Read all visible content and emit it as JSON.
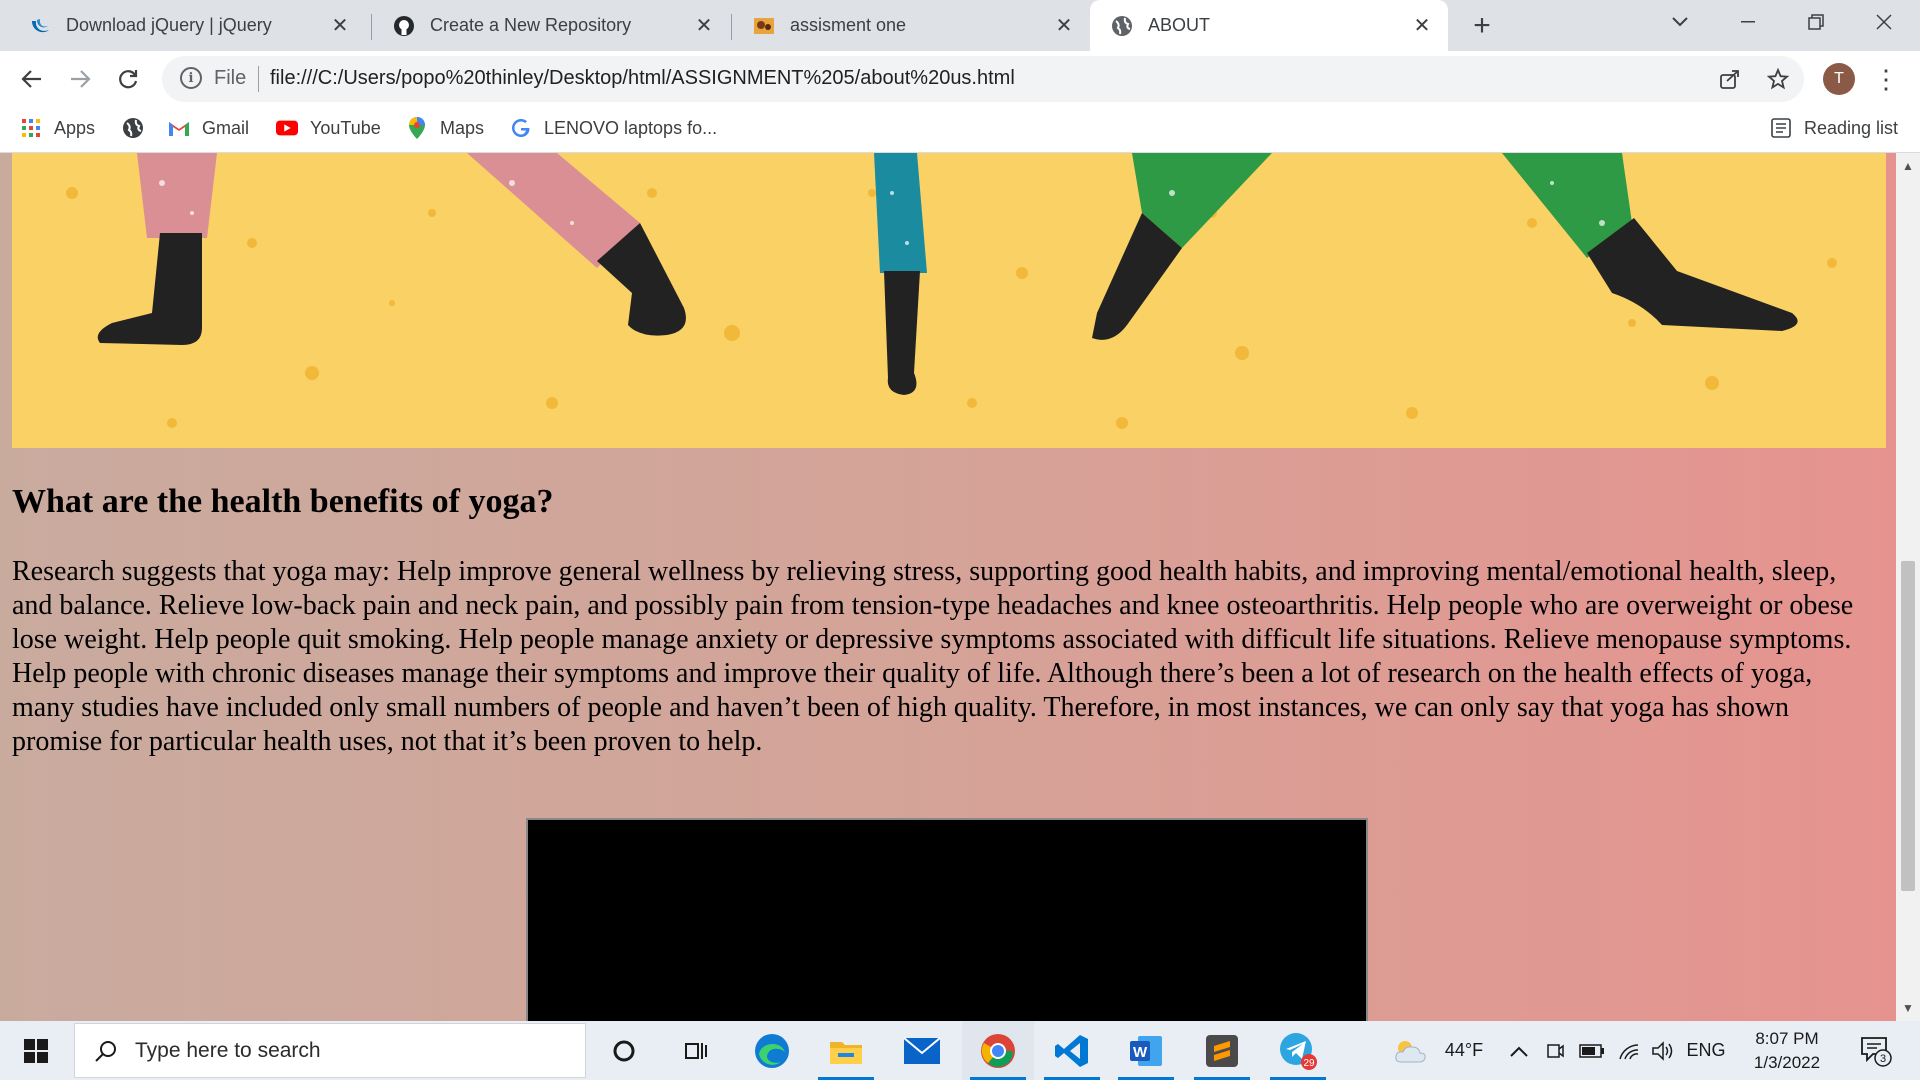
{
  "browser": {
    "tabs": [
      {
        "title": "Download jQuery | jQuery",
        "icon": "jquery-icon"
      },
      {
        "title": "Create a New Repository",
        "icon": "github-icon"
      },
      {
        "title": "assisment one",
        "icon": "site-favicon-icon"
      },
      {
        "title": "ABOUT",
        "icon": "globe-icon",
        "active": true
      }
    ],
    "omnibox": {
      "scheme_label": "File",
      "url": "file:///C:/Users/popo%20thinley/Desktop/html/ASSIGNMENT%205/about%20us.html"
    },
    "avatar_letter": "T",
    "bookmarks": [
      {
        "label": "Apps",
        "icon": "apps-grid-icon"
      },
      {
        "label": "",
        "icon": "globe-icon"
      },
      {
        "label": "Gmail",
        "icon": "gmail-icon"
      },
      {
        "label": "YouTube",
        "icon": "youtube-icon"
      },
      {
        "label": "Maps",
        "icon": "maps-icon"
      },
      {
        "label": "LENOVO laptops fo...",
        "icon": "google-icon"
      }
    ],
    "reading_list_label": "Reading list"
  },
  "page": {
    "heading": "What are the health benefits of yoga?",
    "paragraph": "Research suggests that yoga may: Help improve general wellness by relieving stress, supporting good health habits, and improving mental/emotional health, sleep, and balance. Relieve low-back pain and neck pain, and possibly pain from tension-type headaches and knee osteoarthritis. Help people who are overweight or obese lose weight. Help people quit smoking. Help people manage anxiety or depressive symptoms associated with difficult life situations. Relieve menopause symptoms. Help people with chronic diseases manage their symptoms and improve their quality of life. Although there’s been a lot of research on the health effects of yoga, many studies have included only small numbers of people and haven’t been of high quality. Therefore, in most instances, we can only say that yoga has shown promise for particular health uses, not that it’s been proven to help.",
    "banner_colors": {
      "background": "#f9d165",
      "pink": "#d98f94",
      "teal": "#1b8ba0",
      "green": "#2e9a45",
      "skin": "#222222"
    }
  },
  "taskbar": {
    "search_placeholder": "Type here to search",
    "apps": [
      "cortana-icon",
      "task-view-icon",
      "edge-icon",
      "file-explorer-icon",
      "mail-icon",
      "chrome-icon",
      "vscode-icon",
      "word-icon",
      "sublime-text-icon",
      "telegram-icon"
    ],
    "telegram_badge": "29",
    "weather_temp": "44°F",
    "language": "ENG",
    "time": "8:07 PM",
    "date": "1/3/2022",
    "notification_count": "3"
  }
}
